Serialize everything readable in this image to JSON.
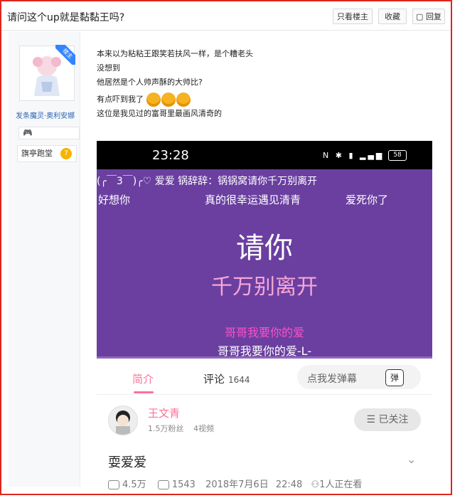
{
  "header": {
    "title": "请问这个up就是黏黏王吗?",
    "only_op_label": "只看楼主",
    "collect_label": "收藏",
    "reply_label": "回复"
  },
  "op": {
    "badge_label": "楼主",
    "username": "发条魔灵·奥利安娜",
    "forum_tag": "旗亭跑堂",
    "level": "7"
  },
  "post": {
    "lines": [
      "本来以为粘粘王跟笑若扶风一样，是个糟老头",
      "没想到",
      "他居然是个人帅声酥的大帅比?",
      "有点吓到我了",
      "这位是我见过的富哥里最画风清奇的"
    ]
  },
  "phone": {
    "time": "23:28",
    "battery": "58",
    "danmaku_top": "(╭￣3￣)╭♡ 爱爱 锅辞辞：锅锅窝请你千万别离开",
    "danmaku_2_left": "好想你",
    "danmaku_2_mid": "真的很幸运遇见清青",
    "danmaku_2_right": "爱死你了",
    "script_line1": "请你",
    "script_line2": "千万别离开",
    "lyric_pink": "哥哥我要你的爱",
    "lyric_white": "哥哥我要你的爱-L-"
  },
  "tabs": {
    "intro": "简介",
    "comments": "评论",
    "comment_count": "1644",
    "danmaku_placeholder": "点我发弹幕",
    "danmaku_btn": "弹"
  },
  "uploader": {
    "name": "王文青",
    "fans": "1.5万粉丝",
    "videos": "4视频",
    "follow_label": "☰ 已关注"
  },
  "video": {
    "title": "耍爱爱",
    "plays": "4.5万",
    "danmaku_count": "1543",
    "date": "2018年7月6日",
    "time": "22:48",
    "watching": "1人正在看"
  }
}
